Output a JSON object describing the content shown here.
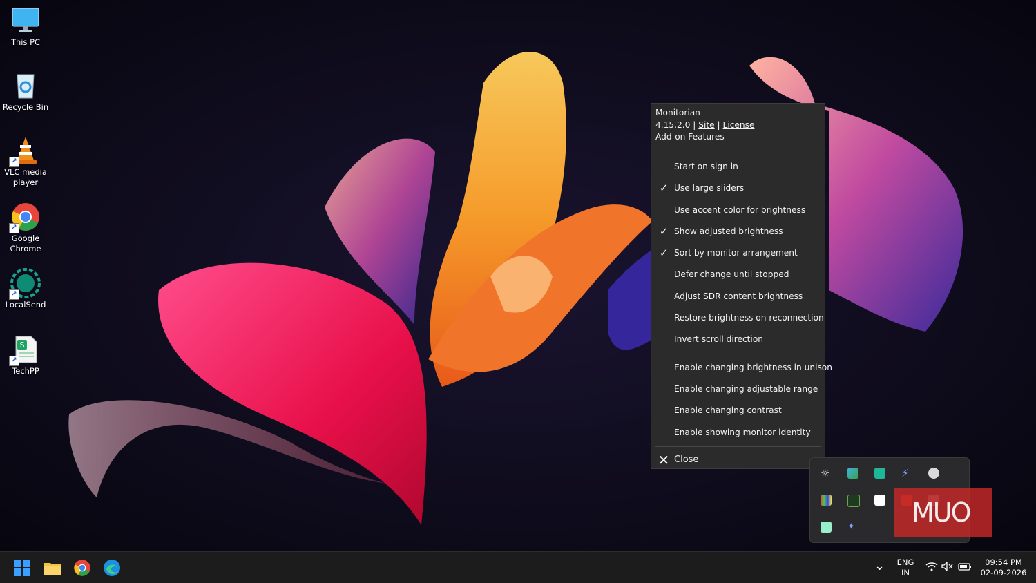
{
  "desktop": {
    "icons": [
      {
        "label": "This PC"
      },
      {
        "label": "Recycle Bin"
      },
      {
        "label": "VLC media player"
      },
      {
        "label": "Google Chrome"
      },
      {
        "label": "LocalSend"
      },
      {
        "label": "TechPP"
      }
    ]
  },
  "menu": {
    "app_name": "Monitorian",
    "version": "4.15.2.0",
    "separator": "|",
    "site_link": "Site",
    "license_link": "License",
    "addon": "Add-on Features",
    "items": [
      {
        "label": "Start on sign in",
        "check": ""
      },
      {
        "label": "Use large sliders",
        "check": "✓"
      },
      {
        "label": "Use accent color for brightness",
        "check": ""
      },
      {
        "label": "Show adjusted brightness",
        "check": "✓"
      },
      {
        "label": "Sort by monitor arrangement",
        "check": "✓"
      },
      {
        "label": "Defer change until stopped",
        "check": ""
      },
      {
        "label": "Adjust SDR content brightness",
        "check": ""
      },
      {
        "label": "Restore brightness on reconnection",
        "check": ""
      },
      {
        "label": "Invert scroll direction",
        "check": ""
      }
    ],
    "items2": [
      {
        "label": "Enable changing brightness in unison"
      },
      {
        "label": "Enable changing adjustable range"
      },
      {
        "label": "Enable changing contrast"
      },
      {
        "label": "Enable showing monitor identity"
      }
    ],
    "close_label": "Close",
    "close_glyph": "✕"
  },
  "watermark": "MUO",
  "taskbar": {
    "lang_line1": "ENG",
    "lang_line2": "IN",
    "time": "09:54 PM",
    "date": "02-09-2026",
    "chevron": "⌄"
  },
  "colors": {
    "menu_bg": "#2b2b2b",
    "taskbar_bg": "#1c1c1c",
    "accent": "#0a84ff"
  }
}
